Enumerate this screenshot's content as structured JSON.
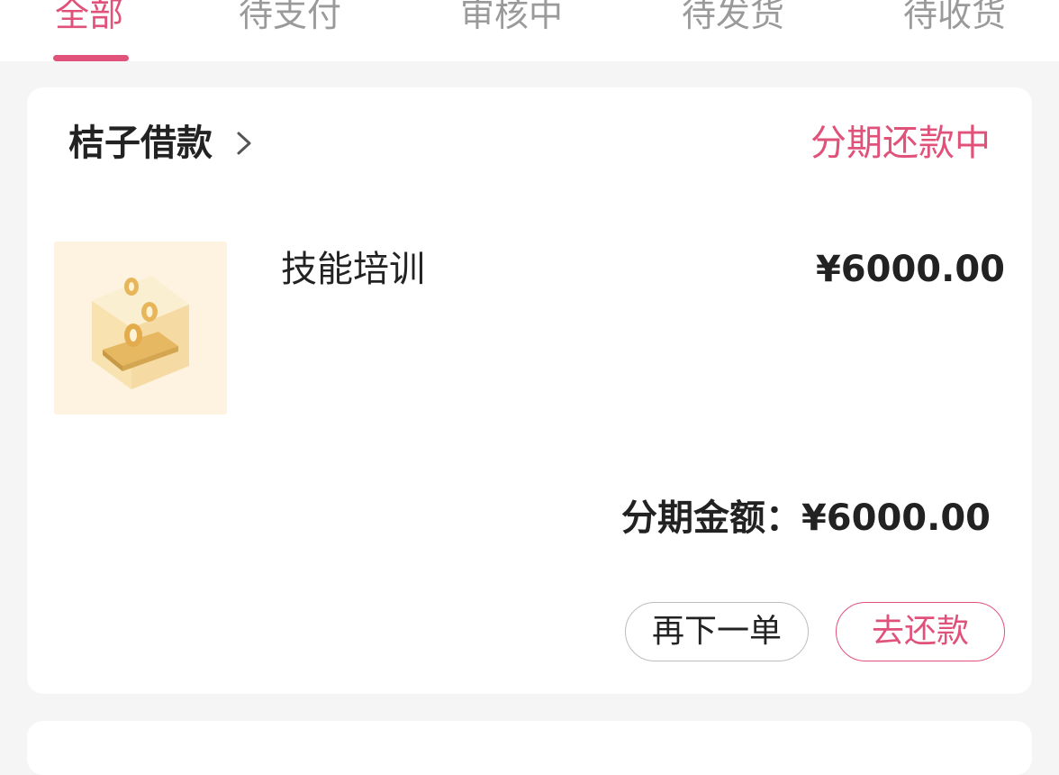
{
  "tabs": [
    {
      "label": "全部",
      "active": true
    },
    {
      "label": "待支付",
      "active": false
    },
    {
      "label": "审核中",
      "active": false
    },
    {
      "label": "待发货",
      "active": false
    },
    {
      "label": "待收货",
      "active": false
    }
  ],
  "order": {
    "merchant": "桔子借款",
    "status": "分期还款中",
    "product_name": "技能培训",
    "price": "¥6000.00",
    "installment_amount": "分期金额：¥6000.00",
    "reorder_label": "再下一单",
    "repay_label": "去还款"
  },
  "colors": {
    "accent": "#e0527a",
    "text": "#222222",
    "muted": "#9a9a9a",
    "background": "#f5f5f5"
  },
  "icons": {
    "merchant_chevron": "chevron-right-icon",
    "product_image": "coin-box-icon"
  }
}
